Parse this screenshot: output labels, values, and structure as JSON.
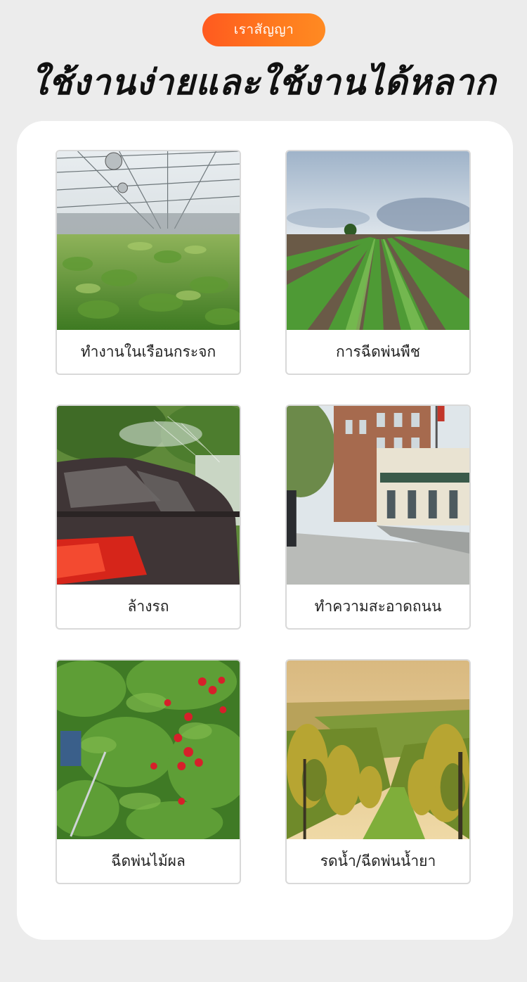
{
  "header": {
    "badge": "เราสัญญา",
    "title": "ใช้งานง่ายและใช้งานได้หลากหลาย"
  },
  "scenes": [
    {
      "caption": "ทำงานในเรือนกระจก",
      "image": "greenhouse-image"
    },
    {
      "caption": "การฉีดพ่นพืช",
      "image": "crop-field-image"
    },
    {
      "caption": "ล้างรถ",
      "image": "car-wash-image"
    },
    {
      "caption": "ทำความสะอาดถนน",
      "image": "street-image"
    },
    {
      "caption": "ฉีดพ่นไม้ผล",
      "image": "fruit-tree-image"
    },
    {
      "caption": "รดน้ำ/ฉีดพ่นน้ำยา",
      "image": "vineyard-image"
    }
  ],
  "colors": {
    "accent": "#ff6a1f",
    "background": "#ececec",
    "panel": "#ffffff"
  }
}
